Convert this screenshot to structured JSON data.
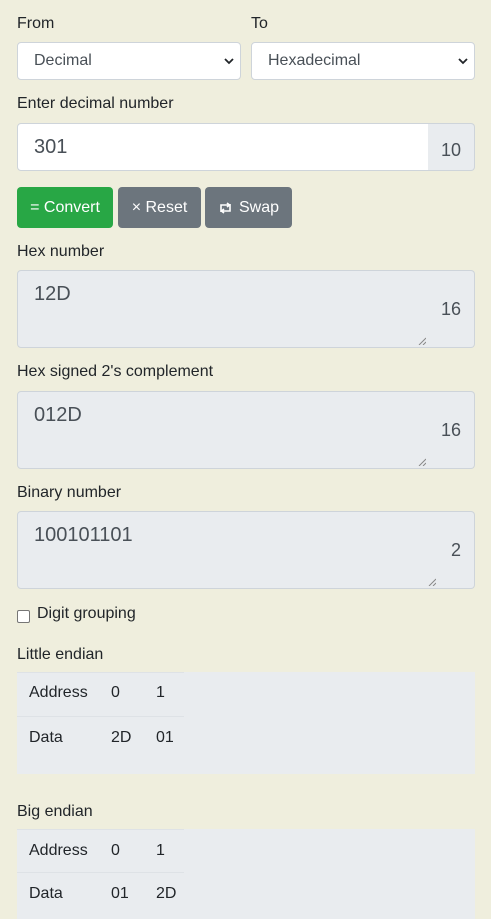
{
  "from": {
    "label": "From",
    "value": "Decimal"
  },
  "to": {
    "label": "To",
    "value": "Hexadecimal"
  },
  "decimal_input": {
    "label": "Enter decimal number",
    "value": "301",
    "base": "10"
  },
  "buttons": {
    "convert": "= Convert",
    "reset": "× Reset",
    "swap": "Swap"
  },
  "hex_output": {
    "label": "Hex number",
    "value": "12D",
    "base": "16"
  },
  "twos_output": {
    "label": "Hex signed 2's complement",
    "value": "012D",
    "base": "16"
  },
  "binary_output": {
    "label": "Binary number",
    "value": "100101101",
    "base": "2"
  },
  "digit_grouping": {
    "label": "Digit grouping",
    "checked": false
  },
  "little_endian": {
    "title": "Little endian",
    "address_label": "Address",
    "data_label": "Data",
    "addresses": [
      "0",
      "1"
    ],
    "data": [
      "2D",
      "01"
    ]
  },
  "big_endian": {
    "title": "Big endian",
    "address_label": "Address",
    "data_label": "Data",
    "addresses": [
      "0",
      "1"
    ],
    "data": [
      "01",
      "2D"
    ]
  },
  "colors": {
    "page_bg": "#efeedd",
    "convert_bg": "#28a745",
    "secondary_bg": "#6c757d"
  },
  "icons": {
    "select_chevron": "chevron-down-icon",
    "swap": "swap-icon"
  }
}
